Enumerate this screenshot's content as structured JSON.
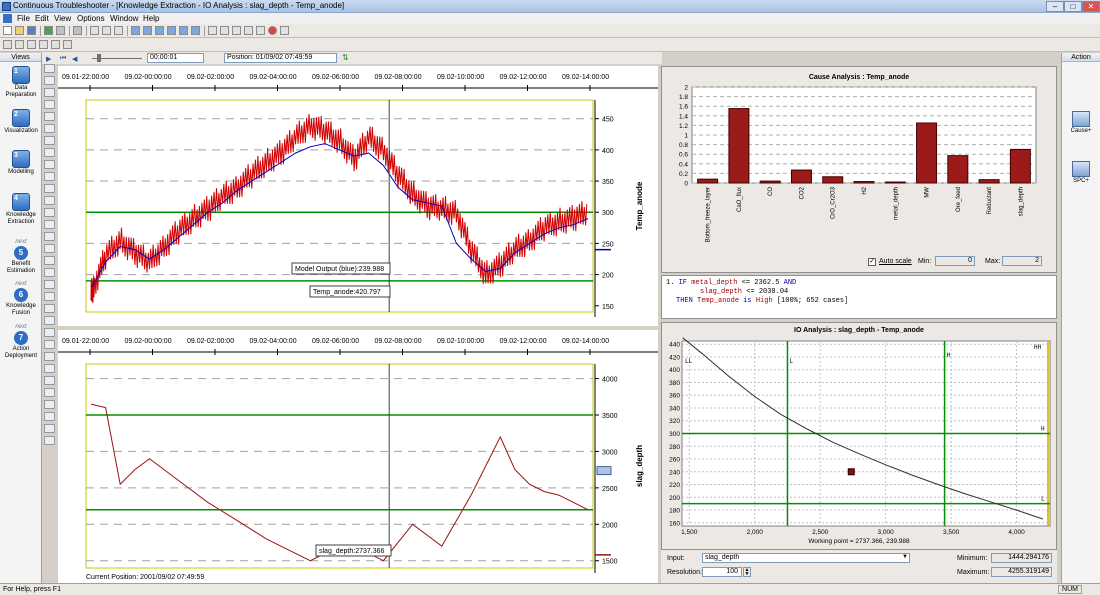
{
  "window": {
    "title": "Continuous Troubleshooter - [Knowledge Extraction - IO Analysis : slag_depth - Temp_anode]",
    "minimize": "–",
    "maximize": "□",
    "close": "✕"
  },
  "menu": [
    "File",
    "Edit",
    "View",
    "Options",
    "Window",
    "Help"
  ],
  "playback": {
    "step": "00:00:01",
    "position": "Position: 01/09/02 07:49:59"
  },
  "views": {
    "header": "Views",
    "items": [
      {
        "num": "1",
        "label": "Data Preparation",
        "next": false
      },
      {
        "num": "2",
        "label": "Visualization",
        "next": false
      },
      {
        "num": "3",
        "label": "Modelling",
        "next": false
      },
      {
        "num": "4",
        "label": "Knowledge Extraction",
        "next": false
      },
      {
        "num": "5",
        "label": "Benefit Estimation",
        "next": true
      },
      {
        "num": "6",
        "label": "Knowledge Fusion",
        "next": true
      },
      {
        "num": "7",
        "label": "Action Deployment",
        "next": true
      }
    ],
    "next_label": "next"
  },
  "action": {
    "header": "Action",
    "items": [
      "Cause+",
      "SPC+"
    ]
  },
  "trend_top": {
    "time_ticks": [
      "09.01-22:00:00",
      "09.02-00:00:00",
      "09.02-02:00:00",
      "09.02-04:00:00",
      "09.02-06:00:00",
      "09.02-08:00:00",
      "09.02-10:00:00",
      "09.02-12:00:00",
      "09.02-14:00:00"
    ],
    "y_ticks": [
      "450",
      "400",
      "350",
      "300",
      "250",
      "200",
      "150"
    ],
    "ylabel": "Temp_anode",
    "tooltip_model": "Model Output (blue):239.988",
    "tooltip_value": "Temp_anode:420.797"
  },
  "trend_bottom": {
    "time_ticks": [
      "09.01-22:00:00",
      "09.02-00:00:00",
      "09.02-02:00:00",
      "09.02-04:00:00",
      "09.02-06:00:00",
      "09.02-08:00:00",
      "09.02-10:00:00",
      "09.02-12:00:00",
      "09.02-14:00:00"
    ],
    "y_ticks": [
      "4000",
      "3500",
      "3000",
      "2500",
      "2000",
      "1500"
    ],
    "ylabel": "slag_depth",
    "tooltip_value": "slag_depth:2737.366",
    "current_position": "Current Position: 2001/09/02 07:49:59"
  },
  "cause": {
    "title": "Cause Analysis : Temp_anode",
    "auto_scale_label": "Auto scale",
    "min_label": "Min:",
    "min_value": "0",
    "max_label": "Max:",
    "max_value": "2"
  },
  "rule": {
    "line1_num": "1.",
    "line1_kw_if": "IF",
    "line1_var": "metal_depth",
    "line1_op": "<= 2362.5",
    "line1_and": "AND",
    "line2_var": "slag_depth",
    "line2_op": "<= 2038.04",
    "line3_kw_then": "THEN",
    "line3_var": "Temp_anode",
    "line3_kw_is": "is",
    "line3_result": "High",
    "line3_stats": "[100%; 652 cases]"
  },
  "io": {
    "title": "IO Analysis : slag_depth - Temp_anode",
    "working_point": "Working point = 2737.366, 239.988",
    "zone_labels": {
      "LL": "LL",
      "L": "L",
      "H": "H",
      "HH": "HH",
      "L2": "L",
      "H2": "H"
    },
    "input_label": "Input:",
    "input_value": "slag_depth",
    "resolution_label": "Resolution:",
    "resolution_value": "100",
    "minimum_label": "Minimum:",
    "minimum_value": "1444.294176",
    "maximum_label": "Maximum:",
    "maximum_value": "4255.319149"
  },
  "status": {
    "help": "For Help, press F1",
    "num": "NUM"
  },
  "colors": {
    "series": "#d00000",
    "model": "#0000c0",
    "limit": "#009000",
    "bar": "#9b1b1b",
    "slag": "#a01010"
  },
  "chart_data": [
    {
      "type": "bar",
      "title": "Cause Analysis : Temp_anode",
      "categories": [
        "Bottom_freeze_layer",
        "CaO_flux",
        "CO",
        "CO2",
        "CrO_Cr2O3",
        "H2",
        "metal_depth",
        "MW",
        "Ore_feed",
        "Reductant",
        "slag_depth"
      ],
      "values": [
        0.08,
        1.55,
        0.04,
        0.27,
        0.13,
        0.03,
        0.02,
        1.25,
        0.57,
        0.07,
        0.7
      ],
      "ylim": [
        0,
        2
      ],
      "y_ticks": [
        "0",
        "0.2",
        "0.4",
        "0.6",
        "0.8",
        "1",
        "1.2",
        "1.4",
        "1.6",
        "1.8",
        "2"
      ]
    },
    {
      "type": "line",
      "title": "IO Analysis : slag_depth - Temp_anode",
      "x": [
        1450,
        1600,
        1800,
        2000,
        2200,
        2400,
        2600,
        2800,
        3000,
        3200,
        3400,
        3600,
        3800,
        4000,
        4200
      ],
      "values": [
        450,
        425,
        390,
        358,
        330,
        307,
        286,
        268,
        251,
        235,
        220,
        206,
        193,
        180,
        166
      ],
      "xlim": [
        1444.29,
        4255.32
      ],
      "ylim": [
        155,
        445
      ],
      "x_ticks": [
        "1,500",
        "2,000",
        "2,500",
        "3,000",
        "3,500",
        "4,000"
      ],
      "y_ticks": [
        "440",
        "420",
        "400",
        "380",
        "360",
        "340",
        "320",
        "300",
        "280",
        "260",
        "240",
        "220",
        "200",
        "180",
        "160"
      ],
      "working_point": [
        2737.366,
        239.988
      ],
      "vlines": [
        2250,
        3450
      ],
      "hlines": [
        300,
        190
      ]
    },
    {
      "type": "line",
      "title": "",
      "ylabel": "Temp_anode",
      "x_ticks": [
        "09.01-22:00:00",
        "09.02-00:00:00",
        "09.02-02:00:00",
        "09.02-04:00:00",
        "09.02-06:00:00",
        "09.02-08:00:00",
        "09.02-10:00:00",
        "09.02-12:00:00",
        "09.02-14:00:00"
      ],
      "x": [
        0,
        0.1,
        0.5,
        1,
        1.5,
        2,
        2.5,
        3,
        3.5,
        4,
        4.5,
        5,
        5.5,
        6,
        6.5,
        7,
        7.5,
        8,
        8.5,
        9,
        9.5,
        10,
        10.5,
        11,
        11.5,
        12,
        12.5,
        13,
        13.5,
        14,
        14.5,
        15,
        15.5,
        16,
        16.5,
        17
      ],
      "series": [
        {
          "name": "Model Output (blue)",
          "values": [
            180,
            185,
            220,
            245,
            240,
            225,
            240,
            260,
            280,
            300,
            315,
            335,
            350,
            365,
            380,
            395,
            405,
            410,
            400,
            390,
            395,
            375,
            340,
            320,
            315,
            310,
            250,
            225,
            205,
            210,
            235,
            250,
            265,
            275,
            280,
            290
          ]
        },
        {
          "name": "Temp_anode",
          "values": [
            170,
            180,
            230,
            255,
            235,
            220,
            245,
            270,
            290,
            305,
            325,
            340,
            360,
            380,
            395,
            420,
            440,
            430,
            415,
            385,
            420,
            400,
            360,
            330,
            310,
            305,
            300,
            240,
            200,
            215,
            240,
            255,
            275,
            285,
            290,
            300
          ]
        }
      ],
      "ylim": [
        140,
        480
      ],
      "hlines": [
        300,
        190
      ]
    },
    {
      "type": "line",
      "title": "",
      "ylabel": "slag_depth",
      "x_ticks": [
        "09.01-22:00:00",
        "09.02-00:00:00",
        "09.02-02:00:00",
        "09.02-04:00:00",
        "09.02-06:00:00",
        "09.02-08:00:00",
        "09.02-10:00:00",
        "09.02-12:00:00",
        "09.02-14:00:00"
      ],
      "x": [
        0,
        0.5,
        1,
        1.5,
        2,
        3,
        4,
        5,
        6,
        7,
        7.5,
        8,
        8.5,
        9,
        10,
        11,
        12,
        13,
        14,
        14.5,
        15,
        15.5,
        16,
        16.5,
        17
      ],
      "values": [
        3650,
        3600,
        2550,
        2750,
        2900,
        2600,
        2300,
        2050,
        1800,
        1600,
        1500,
        1600,
        1650,
        1700,
        1500,
        2000,
        1700,
        2400,
        3200,
        2750,
        2550,
        2450,
        2400,
        2300,
        2200
      ],
      "ylim": [
        1400,
        4200
      ],
      "hlines": [
        3500,
        2200
      ]
    }
  ]
}
